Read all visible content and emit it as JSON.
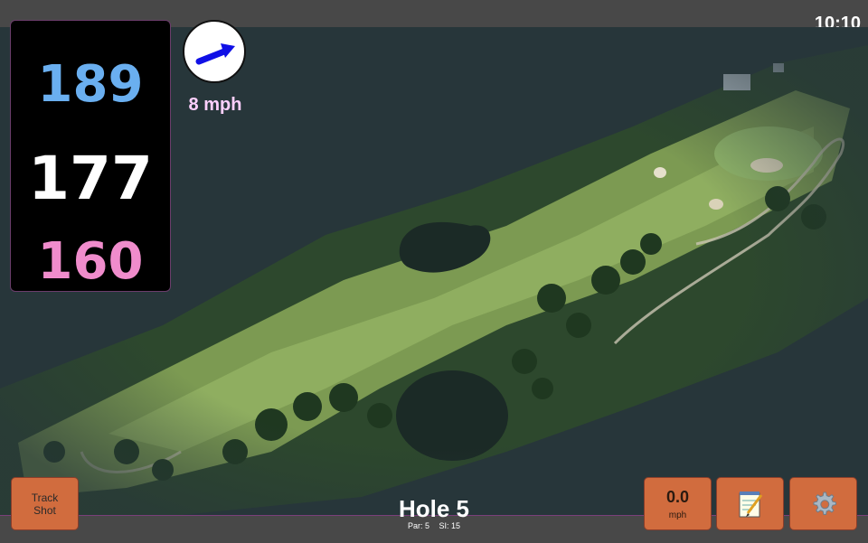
{
  "status": {
    "time": "10:10"
  },
  "distances": {
    "back": "189",
    "middle": "177",
    "front": "160"
  },
  "wind": {
    "speed": "8 mph",
    "icon": "wind-arrow-icon"
  },
  "hole": {
    "title": "Hole 5",
    "par": "Par: 5",
    "stroke_index": "SI: 15"
  },
  "buttons": {
    "track_shot_line1": "Track",
    "track_shot_line2": "Shot",
    "speed_value": "0.0",
    "speed_unit": "mph",
    "notes_icon": "notepad-icon",
    "settings_icon": "gear-icon"
  },
  "colors": {
    "back": "#6aaff0",
    "middle": "#ffffff",
    "front": "#f08ccc",
    "button": "#d16c3e",
    "wind_text": "#ffd0ff"
  }
}
